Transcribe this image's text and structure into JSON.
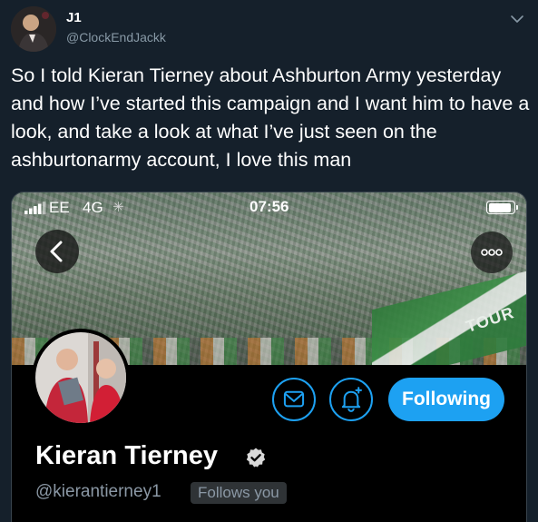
{
  "tweet": {
    "display_name": "J1",
    "handle": "@ClockEndJackk",
    "text": "So I told Kieran Tierney about Ashburton Army yesterday and how I’ve started this campaign and I want him to have a look, and take a look at what I’ve just seen on the ashburtonarmy account, I love this man",
    "icons": {
      "avatar": "user-avatar",
      "menu": "chevron-down-icon"
    }
  },
  "screenshot": {
    "status_bar": {
      "carrier": "EE",
      "network": "4G",
      "time": "07:56",
      "battery_level": 0.9,
      "icons": [
        "signal-bars-icon",
        "activity-spinner-icon",
        "battery-icon"
      ]
    },
    "nav": {
      "back_icon": "chevron-left-icon",
      "more_icon": "more-dots-icon"
    },
    "banner": {
      "sign_text": "TOUR"
    },
    "profile": {
      "name": "Kieran Tierney",
      "handle": "@kierantierney1",
      "follows_you_label": "Follows you",
      "follow_button_label": "Following",
      "message_icon": "envelope-icon",
      "notify_icon": "bell-plus-icon",
      "verified_icon": "verified-badge-icon"
    },
    "colors": {
      "accent": "#1da1f2",
      "background": "#000000",
      "tweet_background": "#15202b",
      "secondary_text": "#8899a6"
    }
  }
}
